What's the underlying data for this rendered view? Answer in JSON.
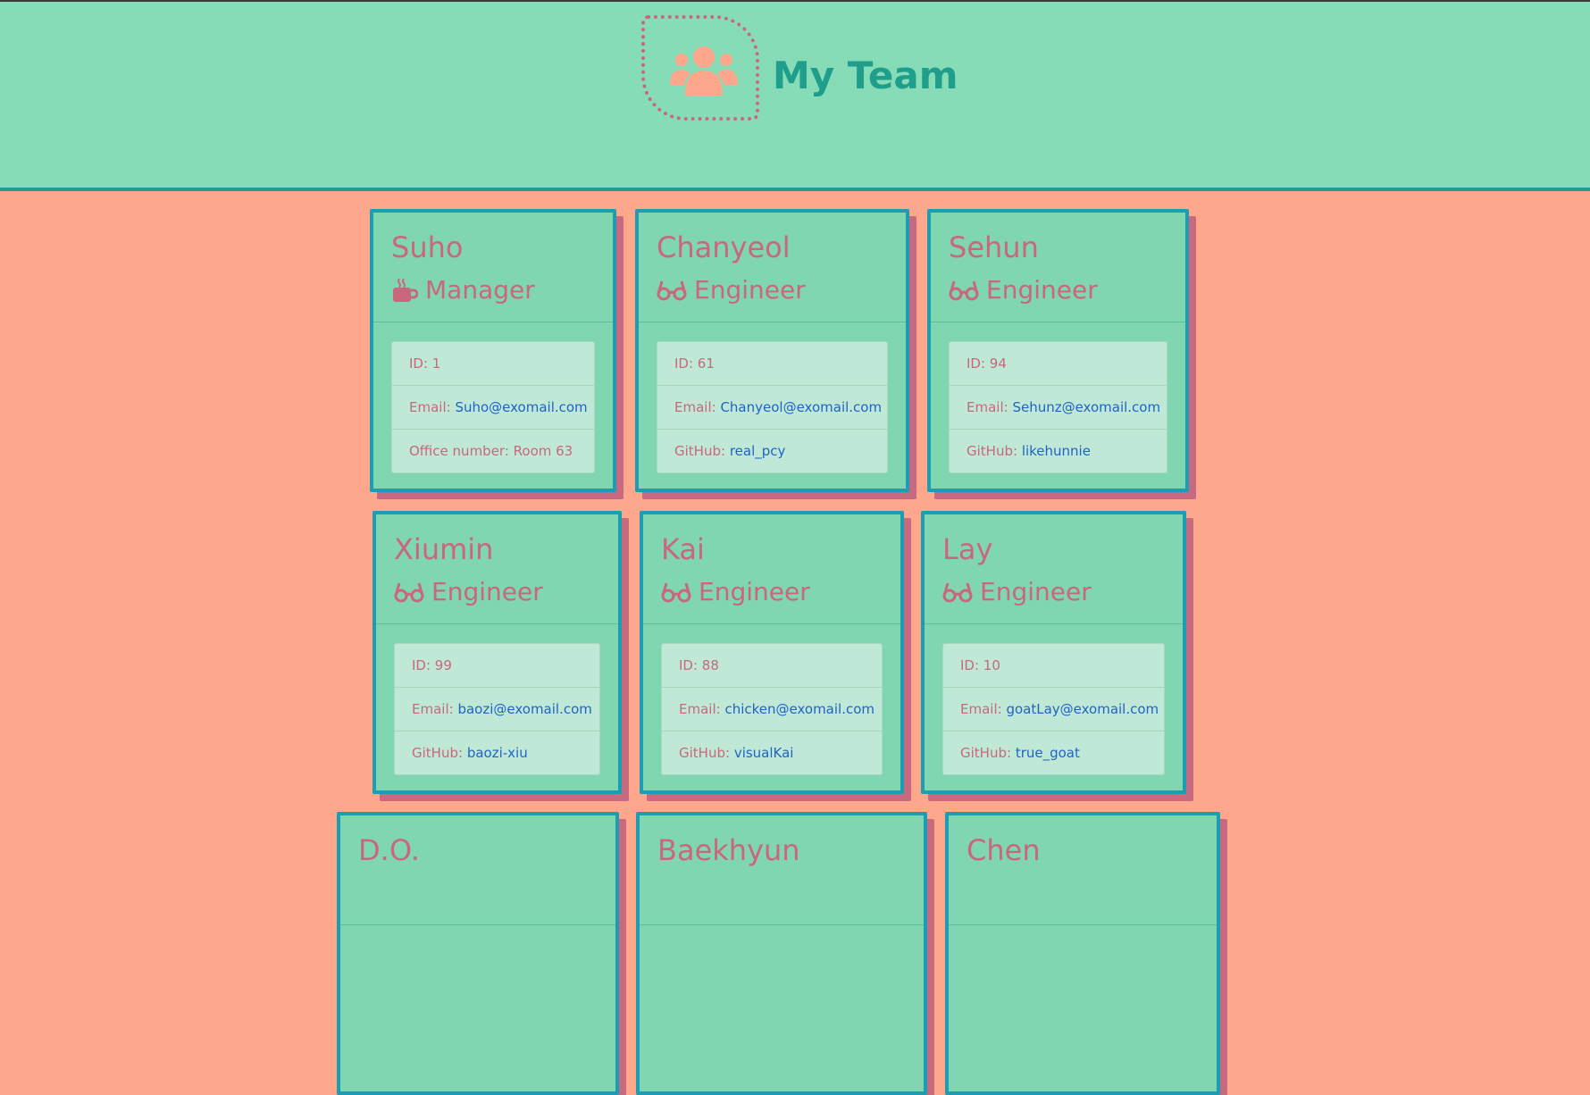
{
  "header": {
    "title": "My Team",
    "logo_icon": "users-group-icon"
  },
  "colors": {
    "header_bg": "#86dcb6",
    "page_bg": "#ffa78c",
    "card_bg": "#80d6b0",
    "card_border": "#1b9eb3",
    "accent_text": "#c9677d"
  },
  "cards": [
    {
      "name": "Suho",
      "role": "Manager",
      "role_icon": "coffee-icon",
      "id_label": "ID: 1",
      "email_label": "Email: ",
      "email": "Suho@exomail.com",
      "extra_label": "Office number: Room 63",
      "extra_value": ""
    },
    {
      "name": "Chanyeol",
      "role": "Engineer",
      "role_icon": "glasses-icon",
      "id_label": "ID: 61",
      "email_label": "Email: ",
      "email": "Chanyeol@exomail.com",
      "extra_label": "GitHub: ",
      "extra_value": "real_pcy"
    },
    {
      "name": "Sehun",
      "role": "Engineer",
      "role_icon": "glasses-icon",
      "id_label": "ID: 94",
      "email_label": "Email: ",
      "email": "Sehunz@exomail.com",
      "extra_label": "GitHub: ",
      "extra_value": "likehunnie"
    },
    {
      "name": "Xiumin",
      "role": "Engineer",
      "role_icon": "glasses-icon",
      "id_label": "ID: 99",
      "email_label": "Email: ",
      "email": "baozi@exomail.com",
      "extra_label": "GitHub: ",
      "extra_value": "baozi-xiu"
    },
    {
      "name": "Kai",
      "role": "Engineer",
      "role_icon": "glasses-icon",
      "id_label": "ID: 88",
      "email_label": "Email: ",
      "email": "chicken@exomail.com",
      "extra_label": "GitHub: ",
      "extra_value": "visualKai"
    },
    {
      "name": "Lay",
      "role": "Engineer",
      "role_icon": "glasses-icon",
      "id_label": "ID: 10",
      "email_label": "Email: ",
      "email": "goatLay@exomail.com",
      "extra_label": "GitHub: ",
      "extra_value": "true_goat"
    },
    {
      "name": "D.O."
    },
    {
      "name": "Baekhyun"
    },
    {
      "name": "Chen"
    }
  ]
}
